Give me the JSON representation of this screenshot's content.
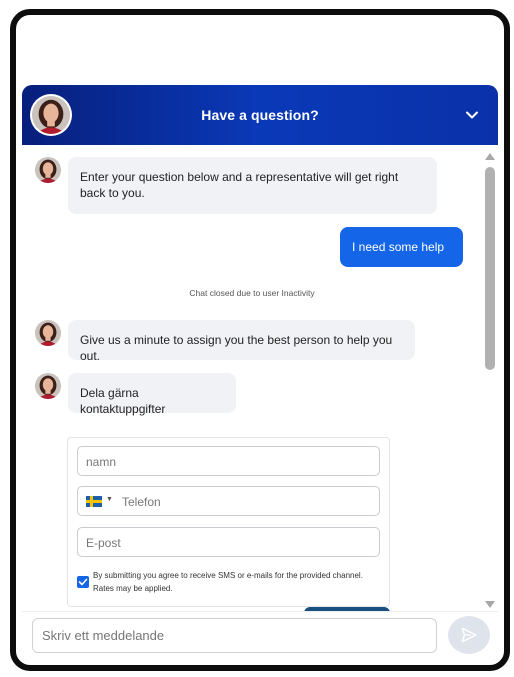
{
  "header": {
    "title": "Have a question?",
    "icon": "chevron-down-icon"
  },
  "messages": [
    {
      "from": "agent",
      "text": "Enter your question below and a representative will get right back to you."
    },
    {
      "from": "user",
      "text": "I need some help"
    },
    {
      "from": "system",
      "text": "Chat closed due to user Inactivity"
    },
    {
      "from": "agent",
      "text": "Give us a minute to assign you the best person to help you out."
    },
    {
      "from": "agent",
      "text": "Dela gärna kontaktuppgifter"
    }
  ],
  "contact_form": {
    "name_placeholder": "namn",
    "phone_placeholder": "Telefon",
    "phone_country_flag": "sweden-flag-icon",
    "email_placeholder": "E-post",
    "consent_checked": true,
    "consent_text": "By submitting you agree to receive SMS or e-mails for the provided channel. Rates may be applied."
  },
  "composer": {
    "placeholder": "Skriv ett meddelande",
    "send_icon": "send-icon"
  },
  "colors": {
    "header_start": "#071f7c",
    "header_end": "#0a39b8",
    "user_bubble": "#1565e8",
    "agent_bubble": "#f1f2f6"
  }
}
